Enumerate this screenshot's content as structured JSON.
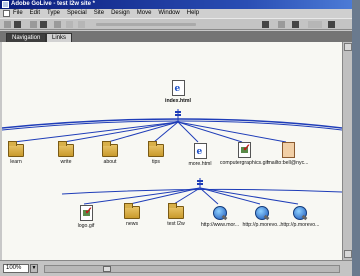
{
  "window": {
    "title": "Adobe GoLive - test l2w site *"
  },
  "menu": [
    "File",
    "Edit",
    "Type",
    "Special",
    "Site",
    "Design",
    "Move",
    "Window",
    "Help"
  ],
  "tabs": [
    {
      "label": "Navigation"
    },
    {
      "label": "Links"
    }
  ],
  "status": {
    "zoom": "100%"
  },
  "sitemap": {
    "root": {
      "label": "index.html"
    },
    "level1": [
      {
        "label": "learn",
        "icon": "folder-icon"
      },
      {
        "label": "write",
        "icon": "folder-icon"
      },
      {
        "label": "about",
        "icon": "folder-icon"
      },
      {
        "label": "tips",
        "icon": "folder-icon"
      },
      {
        "label": "more.html",
        "icon": "html-page-icon"
      },
      {
        "label": "computergraphics.gif",
        "icon": "image-file-icon"
      },
      {
        "label": "mailto:bell@nyc...",
        "icon": "mailto-icon"
      }
    ],
    "level2": [
      {
        "label": "logo.gif",
        "icon": "image-file-icon"
      },
      {
        "label": "news",
        "icon": "folder-icon"
      },
      {
        "label": "test l2w",
        "icon": "folder-icon"
      },
      {
        "label": "http://www.mor...",
        "icon": "web-link-icon"
      },
      {
        "label": "http://p.morevo...",
        "icon": "web-link-icon"
      },
      {
        "label": "http://p.morevo...",
        "icon": "web-link-icon"
      }
    ]
  },
  "colors": {
    "link_line": "#1f3db8",
    "canvas": "#f8f8f3",
    "title_bar": "#0a1c7c"
  }
}
